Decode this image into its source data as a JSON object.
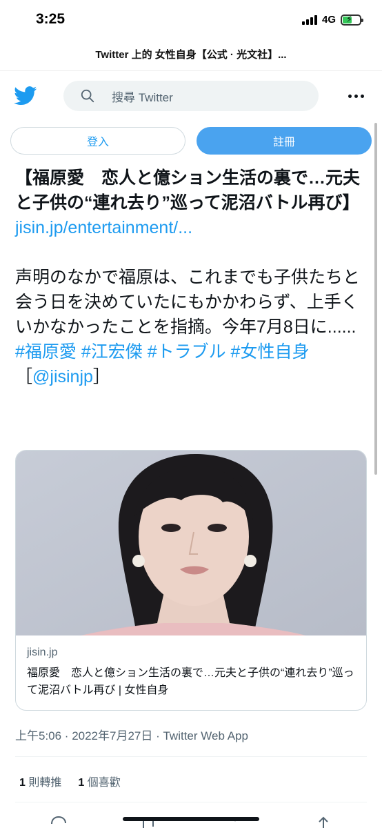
{
  "status_bar": {
    "time": "3:25",
    "network": "4G"
  },
  "page_title": "Twitter 上的 女性自身【公式 · 光文社】...",
  "topbar": {
    "search_placeholder": "搜尋 Twitter"
  },
  "buttons": {
    "login": "登入",
    "signup": "註冊"
  },
  "tweet": {
    "headline": "【福原愛　恋人と億ション生活の裏で…元夫と子供の“連れ去り”巡って泥沼バトル再び】",
    "link": "jisin.jp/entertainment/...",
    "body": "声明のなかで福原は、これまでも子供たちと会う日を決めていたにもかかわらず、上手くいかなかったことを指摘。今年7月8日に......",
    "hashtags": "#福原愛 #江宏傑 #トラブル #女性自身",
    "mention_open": "［",
    "mention": "@jisinjp",
    "mention_close": "］"
  },
  "card": {
    "domain": "jisin.jp",
    "title": "福原愛　恋人と億ション生活の裏で…元夫と子供の“連れ去り”巡って泥沼バトル再び | 女性自身"
  },
  "timestamp": "上午5:06 · 2022年7月27日 · Twitter Web App",
  "stats": {
    "retweets_count": "1",
    "retweets_label": "則轉推",
    "likes_count": "1",
    "likes_label": "個喜歡"
  },
  "colors": {
    "accent": "#1d9bf0",
    "signup_bg": "#4aa3ef",
    "search_bg": "#eff3f4",
    "secondary_text": "#536471"
  }
}
